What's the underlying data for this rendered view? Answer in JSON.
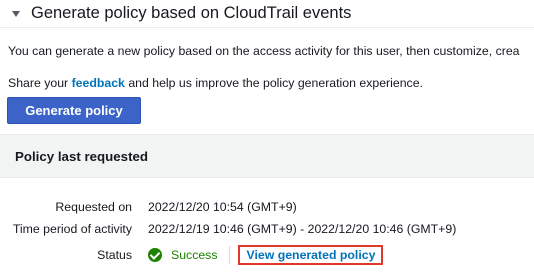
{
  "section": {
    "title": "Generate policy based on CloudTrail events",
    "expanded_icon": "caret-down-icon"
  },
  "description": "You can generate a new policy based on the access activity for this user, then customize, crea",
  "share": {
    "prefix": "Share your ",
    "link": "feedback",
    "suffix": " and help us improve the policy generation experience."
  },
  "generate_button": "Generate policy",
  "panel": {
    "title": "Policy last requested",
    "requested_on": {
      "label": "Requested on",
      "value": "2022/12/20 10:54 (GMT+9)"
    },
    "time_period": {
      "label": "Time period of activity",
      "value": "2022/12/19 10:46 (GMT+9) - 2022/12/20 10:46 (GMT+9)"
    },
    "status": {
      "label": "Status",
      "value": "Success",
      "icon": "success-check-icon",
      "color": "#1d8102",
      "link": "View generated policy"
    }
  },
  "colors": {
    "primary_button": "#3c64c8",
    "link": "#0073bb",
    "highlight_box": "#e0392b",
    "panel_header_bg": "#f2f3f3"
  }
}
